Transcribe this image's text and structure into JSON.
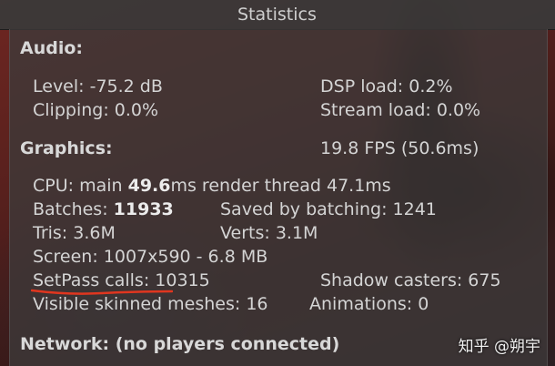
{
  "window": {
    "title": "Statistics"
  },
  "audio": {
    "heading": "Audio:",
    "level": "Level: -75.2 dB",
    "dsp_load": "DSP load: 0.2%",
    "clipping": "Clipping: 0.0%",
    "stream_load": "Stream load: 0.0%"
  },
  "graphics": {
    "heading": "Graphics:",
    "fps": "19.8 FPS (50.6ms)",
    "cpu_prefix": "CPU: main ",
    "cpu_main": "49.6",
    "cpu_suffix": "ms  render thread 47.1ms",
    "batches_prefix": "Batches: ",
    "batches": "11933",
    "saved_by_batching": "Saved by batching: 1241",
    "tris": "Tris: 3.6M",
    "verts": "Verts: 3.1M",
    "screen": "Screen: 1007x590 - 6.8 MB",
    "setpass": "SetPass calls: 10315",
    "shadow_casters": "Shadow casters: 675",
    "skinned_meshes": "Visible skinned meshes: 16",
    "animations": "Animations: 0"
  },
  "network": {
    "heading": "Network: (no players connected)"
  },
  "watermark": "知乎 @朔宇",
  "colors": {
    "underline": "#e0361f",
    "panel": "#3e3a3a",
    "text": "#d4d4d4"
  }
}
